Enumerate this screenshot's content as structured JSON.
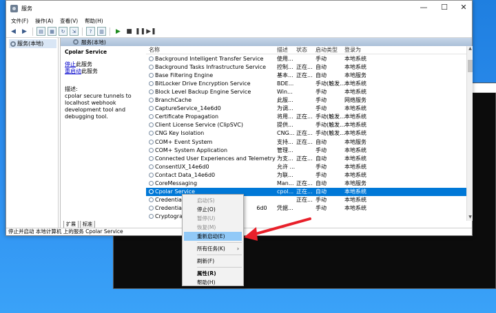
{
  "window": {
    "title": "服务"
  },
  "menubar": [
    "文件(F)",
    "操作(A)",
    "查看(V)",
    "帮助(H)"
  ],
  "tree": {
    "root": "服务(本地)"
  },
  "panel": {
    "header": "服务(本地)"
  },
  "desc": {
    "service": "Cpolar Service",
    "stop_text": "停止",
    "stop_suffix": "此服务",
    "restart_text": "重启动",
    "restart_suffix": "此服务",
    "desc_label": "描述:",
    "desc_text": "cpolar secure tunnels to localhost webhook development tool and debugging tool."
  },
  "list": {
    "headers": [
      "名称",
      "描述",
      "状态",
      "启动类型",
      "登录为"
    ],
    "rows": [
      [
        "Background Intelligent Transfer Service",
        "使用...",
        "",
        "手动",
        "本地系统"
      ],
      [
        "Background Tasks Infrastructure Service",
        "控制...",
        "正在...",
        "自动",
        "本地系统"
      ],
      [
        "Base Filtering Engine",
        "基本...",
        "正在...",
        "自动",
        "本地服务"
      ],
      [
        "BitLocker Drive Encryption Service",
        "BDE...",
        "",
        "手动(触发...",
        "本地系统"
      ],
      [
        "Block Level Backup Engine Service",
        "Win...",
        "",
        "手动",
        "本地系统"
      ],
      [
        "BranchCache",
        "此服...",
        "",
        "手动",
        "网络服务"
      ],
      [
        "CaptureService_14e6d0",
        "为调...",
        "",
        "手动",
        "本地系统"
      ],
      [
        "Certificate Propagation",
        "将用...",
        "正在...",
        "手动(触发...",
        "本地系统"
      ],
      [
        "Client License Service (ClipSVC)",
        "提供...",
        "",
        "手动(触发...",
        "本地系统"
      ],
      [
        "CNG Key Isolation",
        "CNG...",
        "正在...",
        "手动(触发...",
        "本地系统"
      ],
      [
        "COM+ Event System",
        "支持...",
        "正在...",
        "自动",
        "本地服务"
      ],
      [
        "COM+ System Application",
        "管理...",
        "",
        "手动",
        "本地系统"
      ],
      [
        "Connected User Experiences and Telemetry",
        "为支...",
        "正在...",
        "自动",
        "本地系统"
      ],
      [
        "ConsentUX_14e6d0",
        "允许 ...",
        "",
        "手动",
        "本地系统"
      ],
      [
        "Contact Data_14e6d0",
        "为联...",
        "",
        "手动",
        "本地系统"
      ],
      [
        "CoreMessaging",
        "Man...",
        "正在...",
        "自动",
        "本地服务"
      ],
      [
        "Cpolar Service",
        "cpol...",
        "正在...",
        "自动",
        "本地系统"
      ],
      [
        "Credential Mar",
        "",
        "正在...",
        "手动",
        "本地系统"
      ],
      [
        "CredentialEnro",
        "凭据...",
        "",
        "手动",
        "本地系统"
      ],
      [
        "Cryptographic",
        "",
        "",
        "",
        ""
      ]
    ],
    "hidden_fragment": "6d0",
    "selected_index": 16
  },
  "tabs": [
    "扩展",
    "标准"
  ],
  "status": "停止并启动 本地计算机 上的服务 Cpolar Service",
  "context_menu": {
    "items": [
      {
        "label": "启动(S)",
        "state": "disabled"
      },
      {
        "label": "停止(O)",
        "state": "normal"
      },
      {
        "label": "暂停(U)",
        "state": "disabled"
      },
      {
        "label": "恢复(M)",
        "state": "disabled"
      },
      {
        "label": "重新启动(E)",
        "state": "highlighted"
      },
      {
        "label": "所有任务(K)",
        "state": "submenu"
      },
      {
        "label": "刷新(F)",
        "state": "normal"
      },
      {
        "label": "属性(R)",
        "state": "bold"
      },
      {
        "label": "帮助(H)",
        "state": "normal"
      }
    ]
  },
  "colors": {
    "selection": "#0078d7",
    "highlight": "#91c9f7",
    "arrow": "#e8202a",
    "desktop": "#2e8ff0"
  }
}
